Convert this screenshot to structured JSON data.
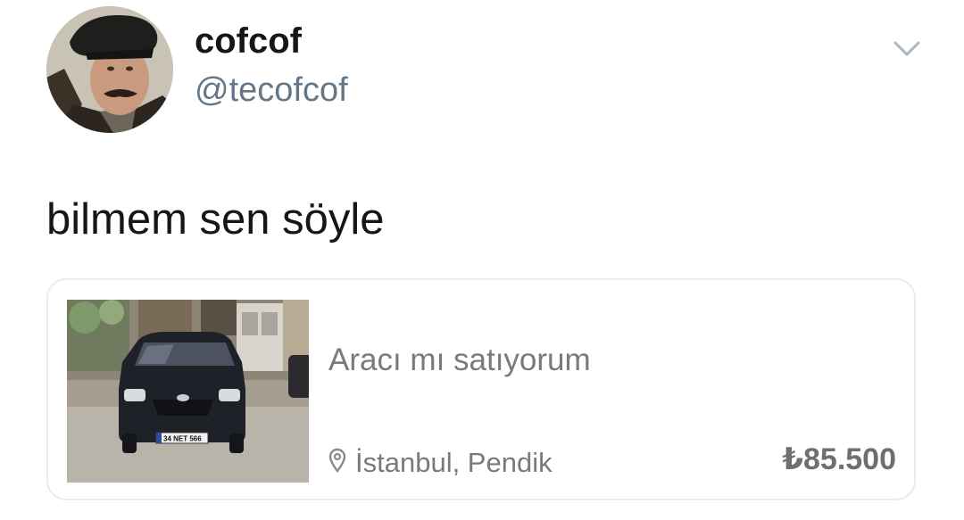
{
  "author": {
    "display_name": "cofcof",
    "handle": "@tecofcof"
  },
  "tweet": {
    "text": "bilmem sen söyle"
  },
  "card": {
    "title": "Aracı mı satıyorum",
    "location": "İstanbul, Pendik",
    "price": "₺85.500",
    "plate_text": "34 NET 566"
  },
  "icons": {
    "menu": "chevron-down-icon",
    "location": "map-pin-icon"
  },
  "colors": {
    "text_primary": "#14171a",
    "text_secondary": "#657786",
    "card_text": "#7a7a7a",
    "card_border": "#e6ecf0"
  }
}
